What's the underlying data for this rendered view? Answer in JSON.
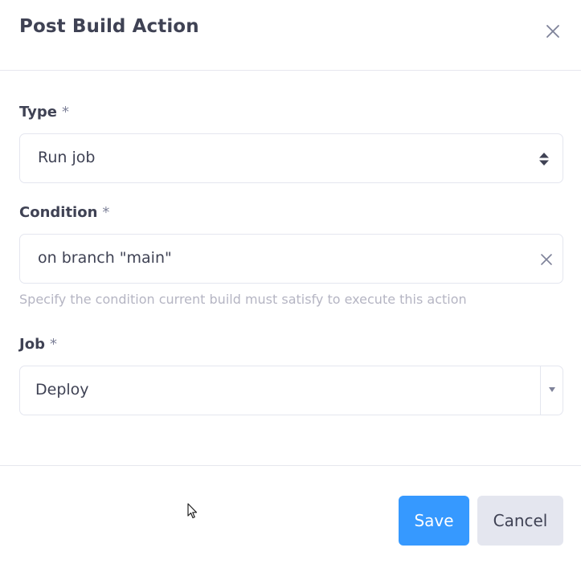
{
  "dialog": {
    "title": "Post Build Action",
    "close_icon": "close-icon"
  },
  "form": {
    "required_marker": "*",
    "type": {
      "label": "Type",
      "value": "Run job",
      "icon": "sort-icon"
    },
    "condition": {
      "label": "Condition",
      "value": "on branch \"main\"",
      "help": "Specify the condition current build must satisfy to execute this action",
      "clear_icon": "clear-icon"
    },
    "job": {
      "label": "Job",
      "value": "Deploy",
      "icon": "caret-down-icon"
    }
  },
  "footer": {
    "save_label": "Save",
    "cancel_label": "Cancel"
  },
  "colors": {
    "primary": "#3699ff",
    "text": "#3f4254",
    "muted": "#b5b5c3",
    "border": "#e4e6ef",
    "secondary_button": "#e4e6ef"
  }
}
